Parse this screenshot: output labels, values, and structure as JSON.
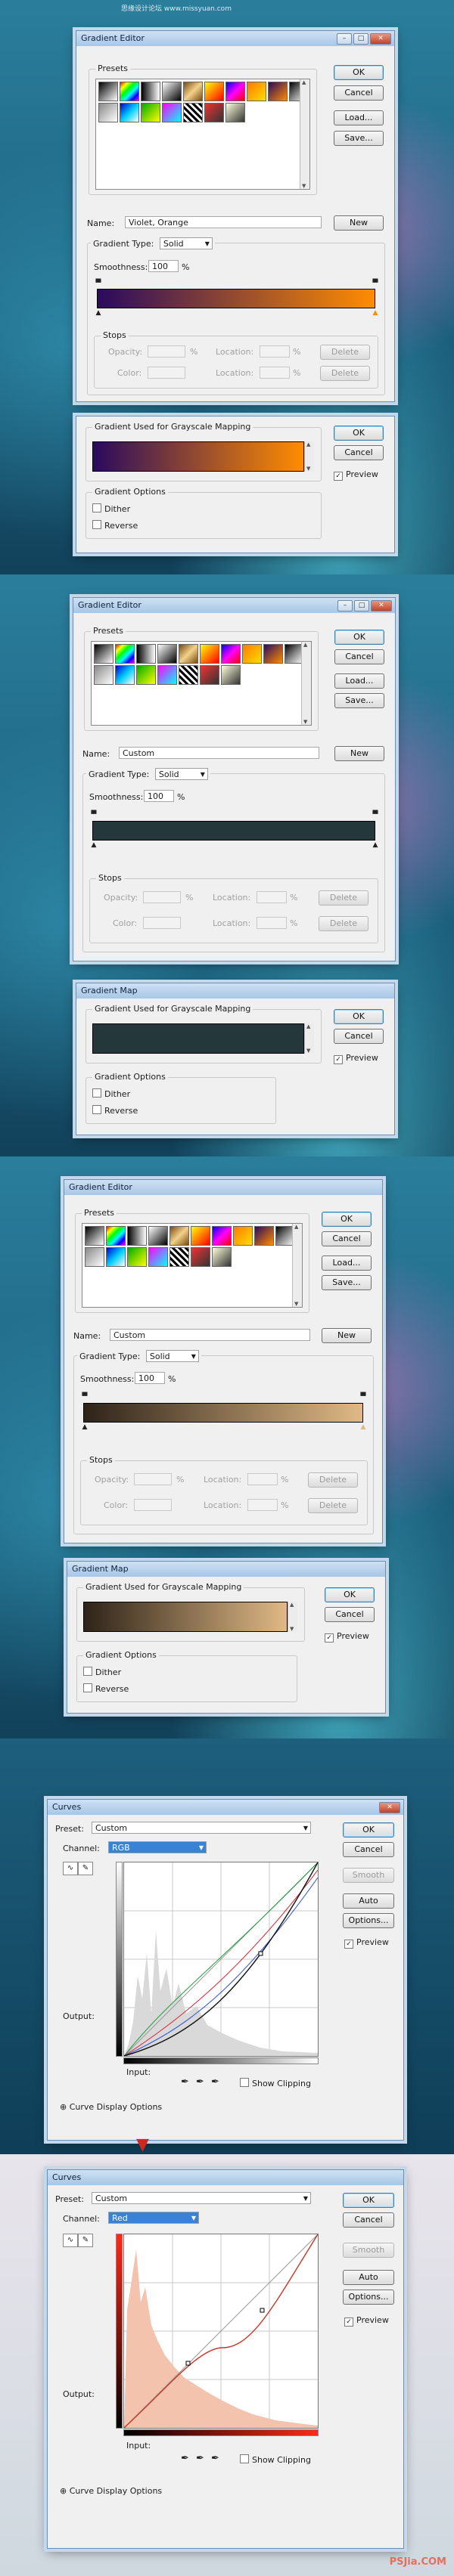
{
  "watermark": "思缘设计论坛  www.missyuan.com",
  "watermark_bottom": "PSJia.COM",
  "icons": [
    "minimize-icon",
    "maximize-icon",
    "close-icon",
    "eyedropper-icon",
    "pencil-icon",
    "curve-tool-icon",
    "expand-icon",
    "stop-icon",
    "arrow-down-icon"
  ],
  "buttons": {
    "ok": "OK",
    "cancel": "Cancel",
    "load": "Load...",
    "save": "Save...",
    "new": "New",
    "delete": "Delete",
    "smooth": "Smooth",
    "auto": "Auto",
    "options": "Options..."
  },
  "gradient_editor": {
    "title": "Gradient Editor",
    "presets_label": "Presets",
    "name_label": "Name:",
    "gradient_type_label": "Gradient Type:",
    "gradient_type_value": "Solid",
    "smoothness_label": "Smoothness:",
    "smoothness_value": "100",
    "percent": "%",
    "stops_label": "Stops",
    "opacity_label": "Opacity:",
    "color_label": "Color:",
    "location_label": "Location:"
  },
  "gradient_map": {
    "title": "Gradient Map",
    "used_label": "Gradient Used for Grayscale Mapping",
    "options_label": "Gradient Options",
    "dither": "Dither",
    "reverse": "Reverse",
    "preview": "Preview"
  },
  "sections": [
    {
      "name_value": "Violet, Orange",
      "gradient": [
        "#2a0a5e",
        "#ff8c00"
      ],
      "show_title": false
    },
    {
      "name_value": "Custom",
      "gradient": [
        "#24373b",
        "#24373b"
      ],
      "show_title": true
    },
    {
      "name_value": "Custom",
      "gradient": [
        "#2e2319",
        "#e0b985"
      ],
      "show_title": true
    }
  ],
  "curves": {
    "title": "Curves",
    "preset_label": "Preset:",
    "preset_value": "Custom",
    "channel_label": "Channel:",
    "output_label": "Output:",
    "input_label": "Input:",
    "show_clipping": "Show Clipping",
    "display_options": "Curve Display Options",
    "preview": "Preview",
    "panels": [
      {
        "channel": "RGB"
      },
      {
        "channel": "Red"
      }
    ]
  }
}
